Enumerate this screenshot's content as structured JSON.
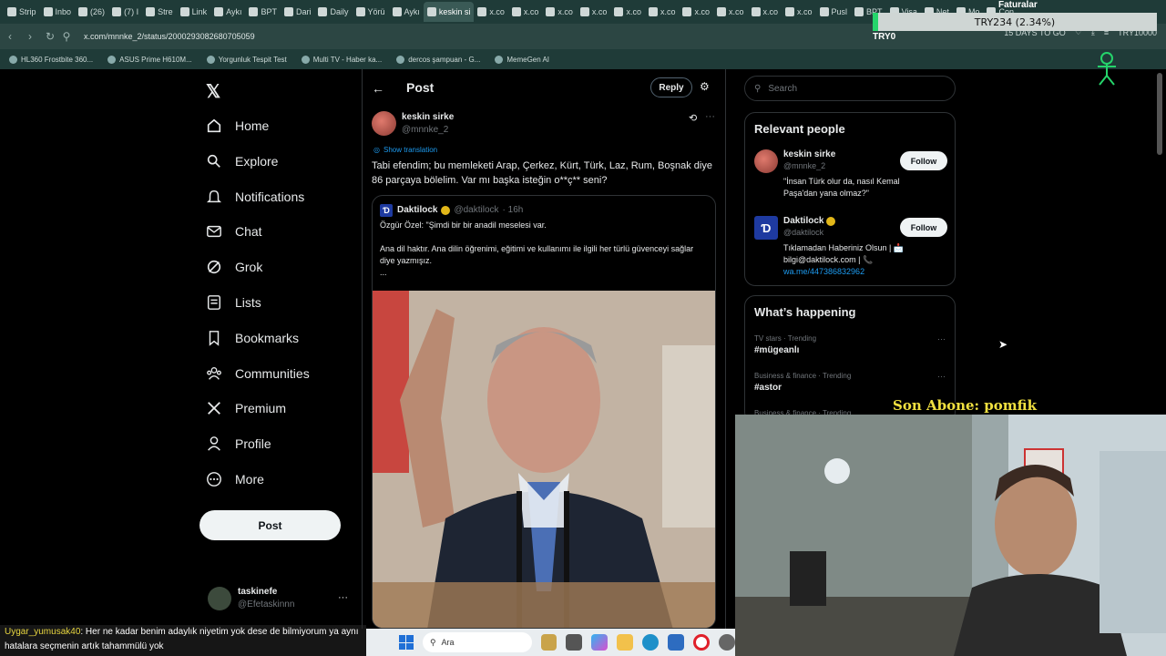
{
  "browser": {
    "tabs": [
      {
        "label": "Strip"
      },
      {
        "label": "Inbo"
      },
      {
        "label": "(26)"
      },
      {
        "label": "(7) I"
      },
      {
        "label": "Stre"
      },
      {
        "label": "Link"
      },
      {
        "label": "Aykı"
      },
      {
        "label": "BPT"
      },
      {
        "label": "Dari"
      },
      {
        "label": "Daily"
      },
      {
        "label": "Yörü"
      },
      {
        "label": "Aykı"
      },
      {
        "label": "keskin si",
        "active": true
      },
      {
        "label": "x.co"
      },
      {
        "label": "x.co"
      },
      {
        "label": "x.co"
      },
      {
        "label": "x.co"
      },
      {
        "label": "x.co"
      },
      {
        "label": "x.co"
      },
      {
        "label": "x.co"
      },
      {
        "label": "x.co"
      },
      {
        "label": "x.co"
      },
      {
        "label": "x.co"
      },
      {
        "label": "Pusl"
      },
      {
        "label": "BPT"
      },
      {
        "label": "Visa"
      },
      {
        "label": "Net"
      },
      {
        "label": "Mo"
      },
      {
        "label": "Con"
      }
    ],
    "url": "x.com/mnnke_2/status/2000293082680705059",
    "addr_right": {
      "days_to_go": "15 DAYS TO GO",
      "currency": "TRY10000"
    },
    "bookmarks": [
      {
        "label": "HL360 Frostbite 360..."
      },
      {
        "label": "ASUS Prime H610M..."
      },
      {
        "label": "Yorgunluk Tespit Test"
      },
      {
        "label": "Multi TV - Haber ka..."
      },
      {
        "label": "dercos şampuan - G..."
      },
      {
        "label": "MemeGen AI"
      }
    ]
  },
  "ticker": {
    "top": "Faturalar",
    "value": "TRY234 (2.34%)",
    "sub": "TRY0"
  },
  "nav": {
    "items": [
      {
        "label": "Home",
        "icon": "home-icon"
      },
      {
        "label": "Explore",
        "icon": "search-icon"
      },
      {
        "label": "Notifications",
        "icon": "bell-icon"
      },
      {
        "label": "Chat",
        "icon": "mail-icon"
      },
      {
        "label": "Grok",
        "icon": "grok-icon"
      },
      {
        "label": "Lists",
        "icon": "list-icon"
      },
      {
        "label": "Bookmarks",
        "icon": "bookmark-icon"
      },
      {
        "label": "Communities",
        "icon": "communities-icon"
      },
      {
        "label": "Premium",
        "icon": "x-icon"
      },
      {
        "label": "Profile",
        "icon": "person-icon"
      },
      {
        "label": "More",
        "icon": "more-circle-icon"
      }
    ],
    "post_label": "Post",
    "account": {
      "name": "taskinefe",
      "handle": "@Efetaskinnn"
    }
  },
  "post": {
    "header_title": "Post",
    "reply_label": "Reply",
    "author_name": "keskin sirke",
    "author_handle": "@mnnke_2",
    "show_translation": "Show translation",
    "text": "Tabi efendim; bu memleketi Arap, Çerkez, Kürt, Türk, Laz, Rum, Boşnak diye 86 parçaya bölelim. Var mı başka isteğin o**ç** seni?",
    "quote": {
      "name": "Daktilock",
      "handle": "@daktilock",
      "time": "· 16h",
      "line1": "Özgür Özel: \"Şimdi bir bir anadil meselesi var.",
      "line2": "Ana dil haktır. Ana dilin öğrenimi, eğitimi ve kullanımı ile ilgili her türlü güvenceyi sağlar diye yazmışız.",
      "line3": "..."
    }
  },
  "right": {
    "search_placeholder": "Search",
    "relevant_title": "Relevant people",
    "people": [
      {
        "name": "keskin sirke",
        "handle": "@mnnke_2",
        "bio": "\"İnsan Türk olur da, nasıl Kemal Paşa'dan yana olmaz?\"",
        "follow": "Follow"
      },
      {
        "name": "Daktilock",
        "handle": "@daktilock",
        "bio": "Tıklamadan Haberiniz Olsun | 📩 bilgi@daktilock.com | 📞",
        "link": "wa.me/447386832962",
        "follow": "Follow"
      }
    ],
    "happening_title": "What’s happening",
    "trends": [
      {
        "category": "TV stars · Trending",
        "tag": "#mügeanlı"
      },
      {
        "category": "Business & finance · Trending",
        "tag": "#astor"
      },
      {
        "category": "Business & finance · Trending",
        "tag": ""
      }
    ]
  },
  "overlay": {
    "subscriber": "Son Abone: pomfik",
    "chat_user": "Uygar_yumusak40",
    "chat_text": ": Her ne kadar benim adaylık niyetim yok dese de bilmiyorum ya aynı hatalara seçmenin artık tahammülü yok",
    "taskbar_search": "Ara"
  },
  "colors": {
    "accent": "#1d9bf0",
    "verified": "#e2b719",
    "ticker_green": "#25d46b"
  }
}
